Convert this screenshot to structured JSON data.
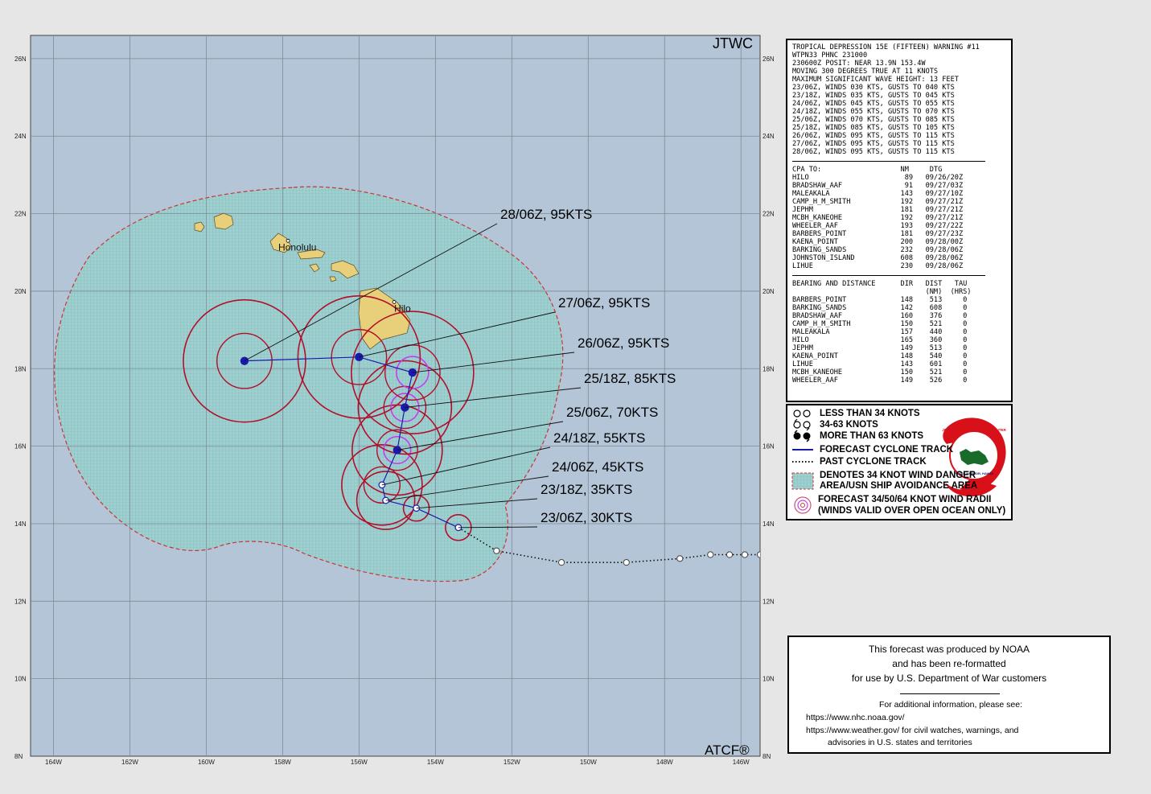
{
  "map": {
    "agency": "JTWC",
    "footer": "ATCF®",
    "lat_labels": [
      "26N",
      "24N",
      "22N",
      "20N",
      "18N",
      "16N",
      "14N",
      "12N",
      "10N",
      "8N"
    ],
    "lat_values": [
      26,
      24,
      22,
      20,
      18,
      16,
      14,
      12,
      10,
      8
    ],
    "lon_labels": [
      "164W",
      "162W",
      "160W",
      "158W",
      "156W",
      "154W",
      "152W",
      "150W",
      "148W",
      "146W"
    ],
    "lon_values": [
      164,
      162,
      160,
      158,
      156,
      154,
      152,
      150,
      148,
      146
    ],
    "extent": {
      "lon_west": 164.6,
      "lon_east": 145.5,
      "lat_south": 8.0,
      "lat_north": 26.6
    },
    "places": [
      {
        "name": "Honolulu",
        "lat": 21.3,
        "lon": 157.86
      },
      {
        "name": "Hilo",
        "lat": 19.72,
        "lon": 155.08
      }
    ],
    "forecast_labels": [
      {
        "text": "28/06Z,  95KTS"
      },
      {
        "text": "27/06Z,  95KTS"
      },
      {
        "text": "26/06Z,  95KTS"
      },
      {
        "text": "25/18Z,  85KTS"
      },
      {
        "text": "25/06Z,  70KTS"
      },
      {
        "text": "24/18Z,  55KTS"
      },
      {
        "text": "24/06Z,  45KTS"
      },
      {
        "text": "23/18Z,  35KTS"
      },
      {
        "text": "23/06Z,  30KTS"
      }
    ],
    "forecast_track": [
      {
        "time": "23/06Z",
        "lat": 13.9,
        "lon": 153.4,
        "kts": 30
      },
      {
        "time": "23/18Z",
        "lat": 14.4,
        "lon": 154.5,
        "kts": 35
      },
      {
        "time": "24/06Z",
        "lat": 14.6,
        "lon": 155.3,
        "kts": 45
      },
      {
        "time": "24/18Z",
        "lat": 15.0,
        "lon": 155.4,
        "kts": 55
      },
      {
        "time": "25/06Z",
        "lat": 15.9,
        "lon": 155.0,
        "kts": 70
      },
      {
        "time": "25/18Z",
        "lat": 17.0,
        "lon": 154.8,
        "kts": 85
      },
      {
        "time": "26/06Z",
        "lat": 17.9,
        "lon": 154.6,
        "kts": 95
      },
      {
        "time": "27/06Z",
        "lat": 18.3,
        "lon": 156.0,
        "kts": 95
      },
      {
        "time": "28/06Z",
        "lat": 18.2,
        "lon": 159.0,
        "kts": 95
      }
    ],
    "past_track": [
      {
        "lat": 13.3,
        "lon": 152.4
      },
      {
        "lat": 13.0,
        "lon": 150.7
      },
      {
        "lat": 13.0,
        "lon": 149.0
      },
      {
        "lat": 13.1,
        "lon": 147.6
      },
      {
        "lat": 13.2,
        "lon": 146.8
      },
      {
        "lat": 13.2,
        "lon": 146.3
      },
      {
        "lat": 13.2,
        "lon": 145.9
      },
      {
        "lat": 13.2,
        "lon": 145.5
      }
    ],
    "colors": {
      "ocean": "#b3c5d6",
      "land": "#e8cf7a",
      "grid": "#7d8c99",
      "danger_fill": "#9fd0d0",
      "danger_edge": "#cc3333",
      "radii_34": "#b0102a",
      "radii_50_64": "#c040f0",
      "track": "#1a1aaa"
    }
  },
  "warning": {
    "lines": [
      "TROPICAL DEPRESSION 15E (FIFTEEN) WARNING #11",
      "WTPN33 PHNC 231000",
      "230600Z POSIT: NEAR 13.9N 153.4W",
      "MOVING 300 DEGREES TRUE AT 11 KNOTS",
      "MAXIMUM SIGNIFICANT WAVE HEIGHT: 13 FEET",
      "23/06Z, WINDS 030 KTS, GUSTS TO 040 KTS",
      "23/18Z, WINDS 035 KTS, GUSTS TO 045 KTS",
      "24/06Z, WINDS 045 KTS, GUSTS TO 055 KTS",
      "24/18Z, WINDS 055 KTS, GUSTS TO 070 KTS",
      "25/06Z, WINDS 070 KTS, GUSTS TO 085 KTS",
      "25/18Z, WINDS 085 KTS, GUSTS TO 105 KTS",
      "26/06Z, WINDS 095 KTS, GUSTS TO 115 KTS",
      "27/06Z, WINDS 095 KTS, GUSTS TO 115 KTS",
      "28/06Z, WINDS 095 KTS, GUSTS TO 115 KTS"
    ],
    "cpa_header": "CPA TO:                   NM     DTG",
    "cpa_lines": [
      "HILO                       89   09/26/20Z",
      "BRADSHAW_AAF               91   09/27/03Z",
      "MALEAKALA                 143   09/27/10Z",
      "CAMP_H_M_SMITH            192   09/27/21Z",
      "JEPHM                     181   09/27/21Z",
      "MCBH_KANEOHE              192   09/27/21Z",
      "WHEELER_AAF               193   09/27/22Z",
      "BARBERS_POINT             181   09/27/23Z",
      "KAENA_POINT               200   09/28/00Z",
      "BARKING_SANDS             232   09/28/06Z",
      "JOHNSTON_ISLAND           608   09/28/06Z",
      "LIHUE                     230   09/28/06Z"
    ],
    "bd_header1": "BEARING AND DISTANCE      DIR   DIST   TAU",
    "bd_header2": "                                (NM)  (HRS)",
    "bd_lines": [
      "BARBERS_POINT             148    513     0",
      "BARKING_SANDS             142    608     0",
      "BRADSHAW_AAF              160    376     0",
      "CAMP_H_M_SMITH            150    521     0",
      "MALEAKALA                 157    440     0",
      "HILO                      165    360     0",
      "JEPHM                     149    513     0",
      "KAENA_POINT               148    540     0",
      "LIHUE                     143    601     0",
      "MCBH_KANEOHE              150    521     0",
      "WHEELER_AAF               149    526     0"
    ]
  },
  "legend": {
    "items": [
      "LESS THAN 34 KNOTS",
      "34-63 KNOTS",
      "MORE THAN 63 KNOTS",
      "FORECAST CYCLONE TRACK",
      "PAST CYCLONE TRACK",
      "DENOTES 34 KNOT WIND DANGER",
      "AREA/USN SHIP AVOIDANCE AREA",
      "FORECAST 34/50/64 KNOT WIND RADII",
      "(WINDS VALID OVER OPEN OCEAN ONLY)"
    ],
    "seal_text": "JOINT TYPHOON WARNING CENTER",
    "seal_sub": "PEARL HARBOR, HAWAII"
  },
  "credit": {
    "line1": "This forecast was produced by NOAA",
    "line2": "and has been re-formatted",
    "line3": "for use by U.S. Department of War customers",
    "line4": "For additional information, please see:",
    "line5": "https://www.nhc.noaa.gov/",
    "line6": "https://www.weather.gov/ for civil watches, warnings, and",
    "line7": "advisories in U.S. states and territories"
  }
}
